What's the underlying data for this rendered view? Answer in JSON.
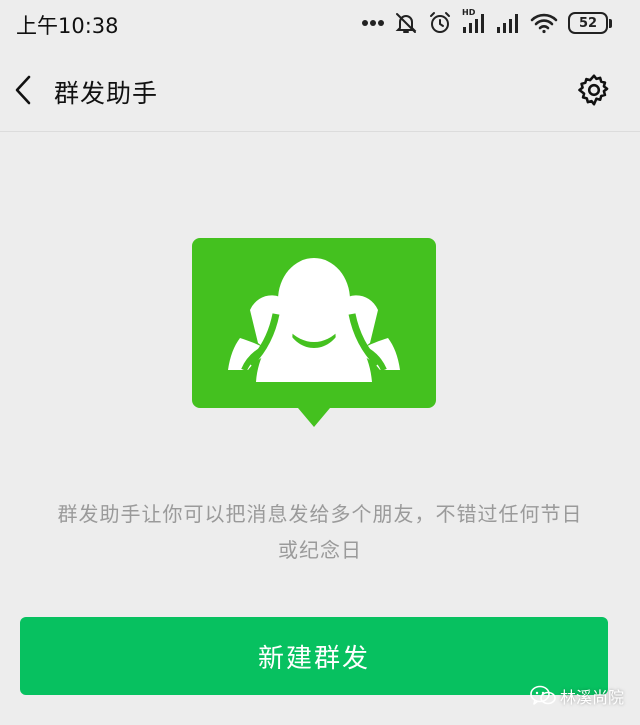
{
  "status_bar": {
    "time": "上午10:38",
    "network_label": "HD",
    "battery_level": "52",
    "icons": [
      "more-dots-icon",
      "notifications-off-icon",
      "alarm-icon",
      "hd-signal-icon",
      "signal-icon",
      "wifi-icon",
      "battery-icon"
    ]
  },
  "nav": {
    "title": "群发助手",
    "back_icon": "chevron-left-icon",
    "settings_icon": "gear-icon"
  },
  "hero": {
    "icon": "group-chat-icon",
    "color": "#44c11f"
  },
  "description": {
    "line1": "群发助手让你可以把消息发给多个朋友，不错过任何节日",
    "line2": "或纪念日"
  },
  "primary_button": {
    "label": "新建群发",
    "color": "#07c160"
  },
  "watermark": {
    "text": "林溪尚院",
    "icon": "wechat-icon"
  }
}
